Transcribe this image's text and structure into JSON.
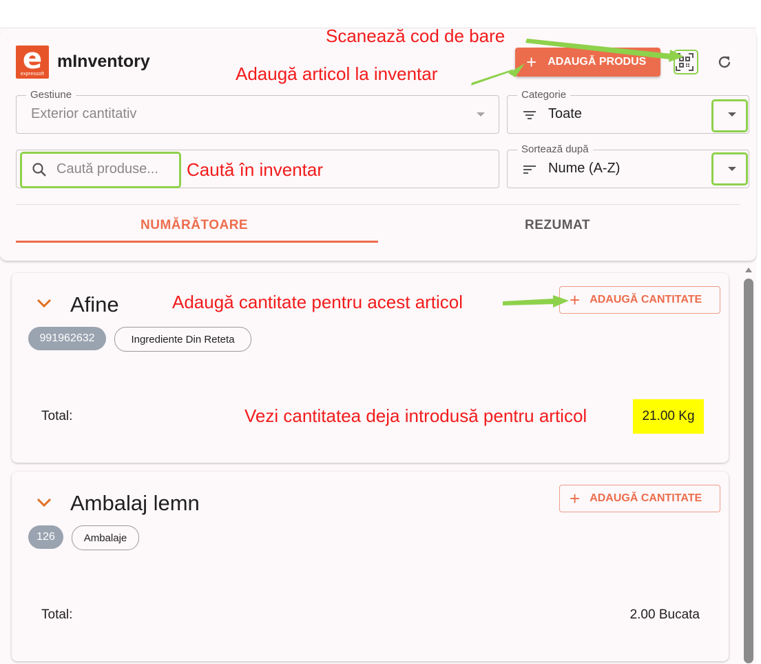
{
  "app": {
    "title": "mInventory",
    "logo_letter": "e",
    "logo_text": "expressoft"
  },
  "toolbar": {
    "add_product_label": "ADAUGĂ PRODUS",
    "scan_icon": "qr-scan-icon",
    "refresh_icon": "refresh-icon"
  },
  "filters": {
    "gestiune": {
      "label": "Gestiune",
      "value": "Exterior cantitativ"
    },
    "categorie": {
      "label": "Categorie",
      "value": "Toate"
    },
    "search": {
      "placeholder": "Caută produse..."
    },
    "sort": {
      "label": "Sortează după",
      "value": "Nume (A-Z)"
    }
  },
  "tabs": [
    {
      "label": "NUMĂRĂTOARE",
      "active": true
    },
    {
      "label": "REZUMAT",
      "active": false
    }
  ],
  "items": [
    {
      "name": "Afine",
      "code": "991962632",
      "category": "Ingrediente Din Reteta",
      "add_quantity_label": "ADAUGĂ CANTITATE",
      "total_label": "Total:",
      "total_value": "21.00 Kg"
    },
    {
      "name": "Ambalaj lemn",
      "code": "126",
      "category": "Ambalaje",
      "add_quantity_label": "ADAUGĂ CANTITATE",
      "total_label": "Total:",
      "total_value": "2.00 Bucata"
    }
  ],
  "annotations": {
    "scan": "Scanează cod de bare",
    "add_item": "Adaugă articol la inventar",
    "search": "Caută în inventar",
    "add_quantity": "Adaugă cantitate pentru acest articol",
    "view_quantity": "Vezi cantitatea deja introdusă pentru articol"
  },
  "colors": {
    "accent": "#ec6d4d",
    "annotation": "#f21b1b",
    "annotation_arrow": "#8ed14b",
    "highlight": "#ffff00",
    "chip_code": "#9aa3b0"
  }
}
